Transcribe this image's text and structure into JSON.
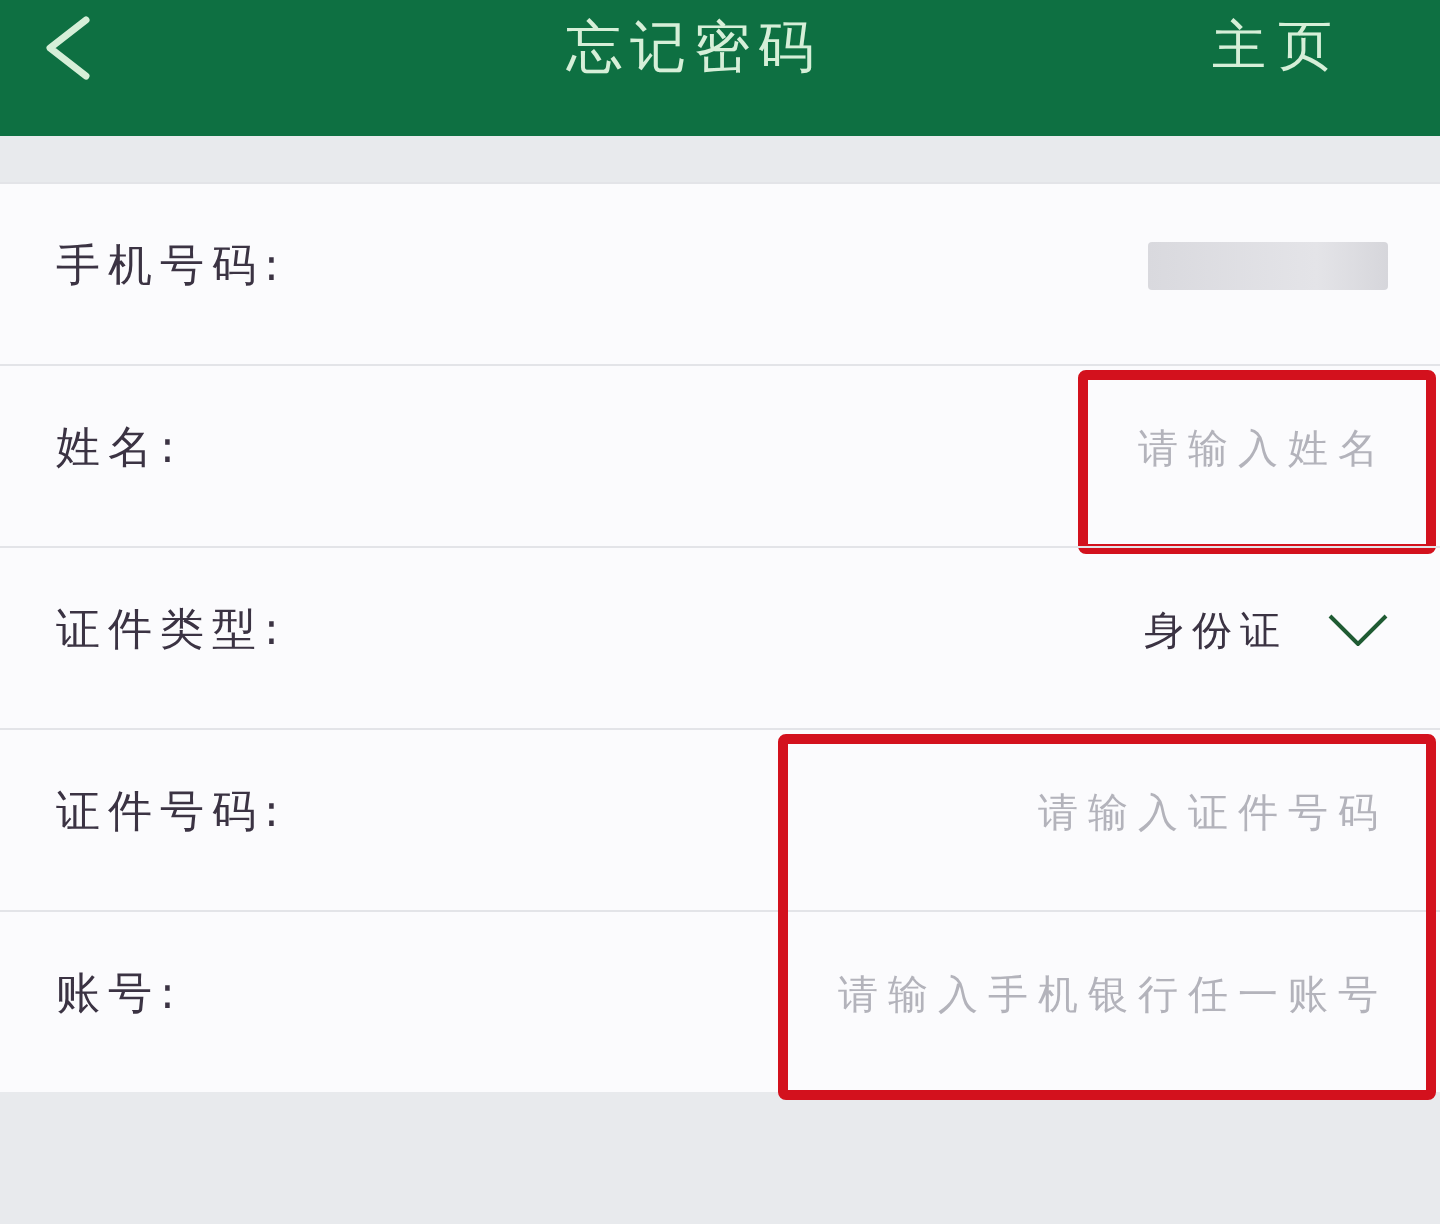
{
  "header": {
    "title": "忘记密码",
    "right_link": "主页"
  },
  "groups": [
    {
      "highlighted": false,
      "rows": [
        {
          "kind": "masked",
          "label": "手机号码:"
        }
      ]
    },
    {
      "highlighted": true,
      "rows": [
        {
          "kind": "input",
          "label": "姓名:",
          "placeholder": "请输入姓名"
        }
      ]
    },
    {
      "highlighted": false,
      "rows": [
        {
          "kind": "select",
          "label": "证件类型:",
          "value": "身份证"
        }
      ]
    },
    {
      "highlighted": true,
      "rows": [
        {
          "kind": "input",
          "label": "证件号码:",
          "placeholder": "请输入证件号码"
        },
        {
          "kind": "input",
          "label": "账号:",
          "placeholder": "请输入手机银行任一账号"
        }
      ]
    }
  ]
}
